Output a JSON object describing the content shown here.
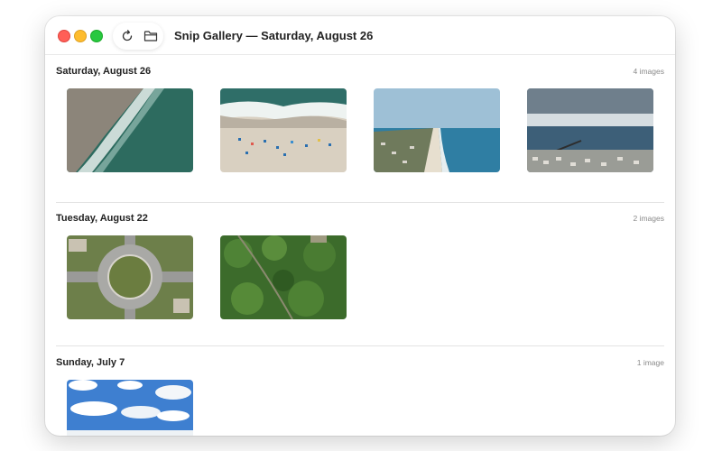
{
  "window": {
    "title": "Snip Gallery — Saturday, August 26"
  },
  "toolbar": {
    "refresh_icon": "refresh-icon",
    "folder_icon": "folder-icon"
  },
  "sections": [
    {
      "title": "Saturday, August 26",
      "count": "4 images",
      "images": [
        "aerial-surf-shoreline",
        "aerial-beach-umbrellas",
        "coastal-town-aerial",
        "pier-under-storm-clouds"
      ]
    },
    {
      "title": "Tuesday, August 22",
      "count": "2 images",
      "images": [
        "roundabout-aerial",
        "forest-canopy-aerial"
      ]
    },
    {
      "title": "Sunday, July 7",
      "count": "1 image",
      "images": [
        "blue-sky-clouds"
      ]
    }
  ],
  "colors": {
    "close": "#ff5f57",
    "minimize": "#febc2e",
    "zoom": "#28c840"
  }
}
